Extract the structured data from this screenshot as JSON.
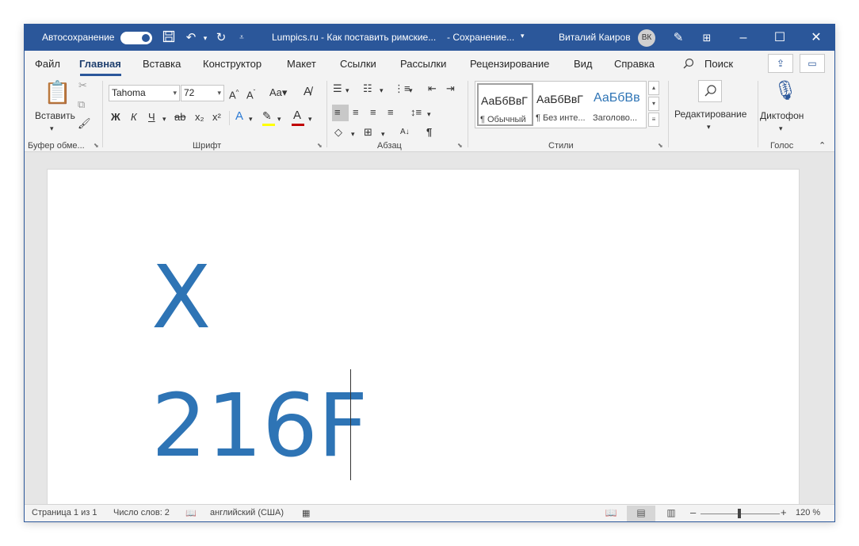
{
  "title_bar": {
    "autosave_label": "Автосохранение",
    "doc_title": "Lumpics.ru - Как поставить римские...",
    "save_status": "-  Сохранение...",
    "user_name": "Виталий Каиров",
    "avatar_initials": "ВК",
    "quick_access_icons": [
      "save-icon",
      "undo-icon",
      "redo-icon",
      "customize-qat-icon"
    ]
  },
  "tabs": [
    "Файл",
    "Главная",
    "Вставка",
    "Конструктор",
    "Макет",
    "Ссылки",
    "Рассылки",
    "Рецензирование",
    "Вид",
    "Справка"
  ],
  "active_tab": "Главная",
  "search_label": "Поиск",
  "ribbon": {
    "clipboard": {
      "paste_label": "Вставить",
      "group_label": "Буфер обме..."
    },
    "font": {
      "font_name": "Tahoma",
      "font_size": "72",
      "group_label": "Шрифт",
      "format_buttons": [
        "Ж",
        "К",
        "Ч",
        "ab",
        "x₂",
        "x²"
      ]
    },
    "paragraph": {
      "group_label": "Абзац"
    },
    "styles": {
      "group_label": "Стили",
      "items": [
        {
          "sample": "АаБбВвГ",
          "name": "¶ Обычный"
        },
        {
          "sample": "АаБбВвГ",
          "name": "¶ Без инте..."
        },
        {
          "sample": "АаБбВв",
          "name": "Заголово..."
        }
      ]
    },
    "editing": {
      "label": "Редактирование"
    },
    "voice": {
      "label": "Диктофон",
      "group_label": "Голос"
    }
  },
  "document": {
    "lines": [
      "Ⅹ",
      "216F"
    ],
    "text_color": "#2e74b5"
  },
  "status_bar": {
    "page": "Страница 1 из 1",
    "words": "Число слов: 2",
    "language": "английский (США)",
    "zoom": "120 %",
    "zoom_level_percent": 120
  },
  "colors": {
    "title_bar": "#2b579a",
    "ribbon_bg": "#f3f3f3",
    "highlight": "#ffff00",
    "font_color": "#c00000"
  }
}
